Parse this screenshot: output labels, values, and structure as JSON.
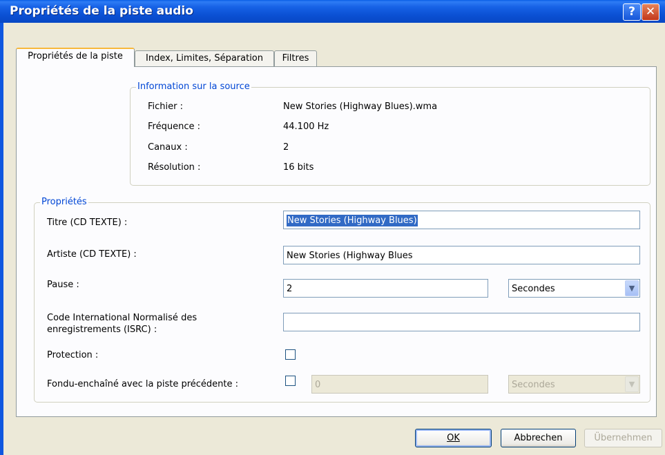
{
  "window": {
    "title": "Propriétés de la piste audio",
    "help_glyph": "?",
    "close_glyph": "✕"
  },
  "tabs": [
    {
      "label": "Propriétés de la piste",
      "active": true
    },
    {
      "label": "Index, Limites, Séparation",
      "active": false
    },
    {
      "label": "Filtres",
      "active": false
    }
  ],
  "source_info": {
    "legend": "Information sur la source",
    "rows": [
      {
        "label": "Fichier :",
        "value": "New Stories (Highway Blues).wma"
      },
      {
        "label": "Fréquence :",
        "value": "44.100 Hz"
      },
      {
        "label": "Canaux :",
        "value": "2"
      },
      {
        "label": "Résolution :",
        "value": "16 bits"
      }
    ]
  },
  "properties": {
    "legend": "Propriétés",
    "title_label": "Titre (CD TEXTE) :",
    "title_value": "New Stories (Highway Blues)",
    "artist_label": "Artiste (CD TEXTE) :",
    "artist_value": "New Stories (Highway Blues",
    "pause_label": "Pause :",
    "pause_value": "2",
    "pause_unit": "Secondes",
    "isrc_label_line1": "Code International Normalisé des",
    "isrc_label_line2": "enregistrements (ISRC) :",
    "isrc_value": "",
    "protection_label": "Protection :",
    "protection_checked": false,
    "crossfade_label": "Fondu-enchaîné avec la piste précédente :",
    "crossfade_checked": false,
    "crossfade_value": "0",
    "crossfade_unit": "Secondes"
  },
  "buttons": {
    "ok": "OK",
    "cancel": "Abbrechen",
    "apply": "Übernehmen"
  },
  "colors": {
    "titlebar": "#0A4FD2",
    "legend_text": "#0046D5",
    "dialog_bg": "#ECE9D8",
    "selection": "#316AC5"
  },
  "icons": {
    "help": "help-icon",
    "close": "close-icon",
    "dropdown": "chevron-down-icon"
  }
}
